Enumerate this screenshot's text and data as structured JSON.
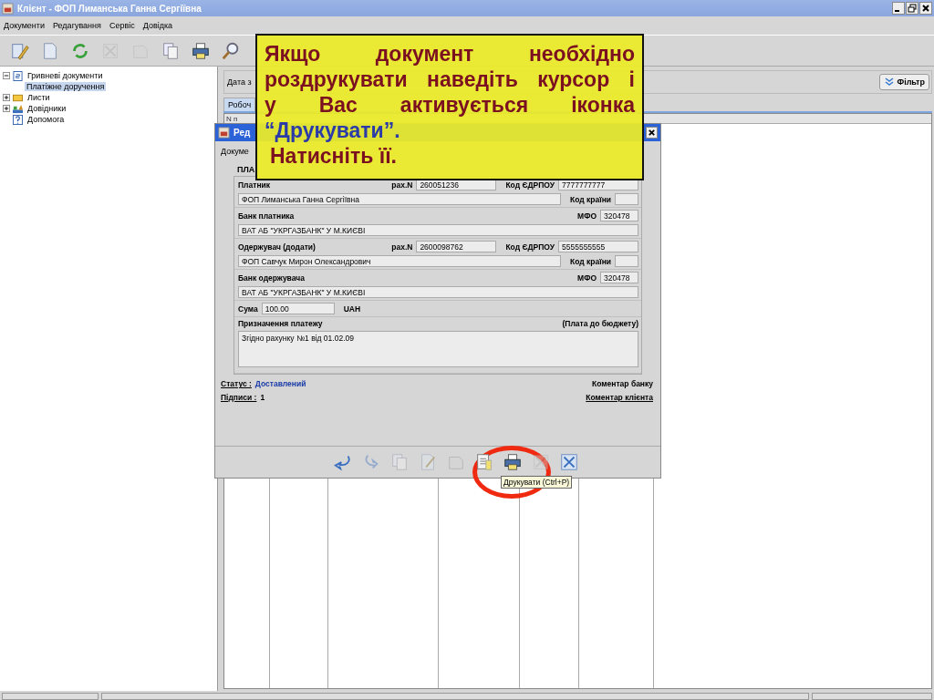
{
  "window": {
    "title": "Клієнт - ФОП Лиманська Ганна Сергіївна"
  },
  "menu": [
    "Документи",
    "Редагування",
    "Сервіс",
    "Довідка"
  ],
  "toolbar": [
    {
      "kind": "edit",
      "disabled": false
    },
    {
      "kind": "document",
      "disabled": false
    },
    {
      "kind": "refresh",
      "disabled": false
    },
    {
      "kind": "delete",
      "disabled": true
    },
    {
      "kind": "sign",
      "disabled": true
    },
    {
      "kind": "copy",
      "disabled": false
    },
    {
      "kind": "print",
      "disabled": false
    },
    {
      "kind": "search",
      "disabled": false
    }
  ],
  "tree": [
    {
      "label": "Гривневі документи",
      "kind": "doc",
      "expanded": true,
      "selected": false,
      "children": [
        {
          "label": "Платіжне доручення",
          "selected": true
        }
      ]
    },
    {
      "label": "Листи",
      "kind": "mail",
      "expanded": false,
      "selected": false
    },
    {
      "label": "Довідники",
      "kind": "books",
      "expanded": false,
      "selected": false
    },
    {
      "label": "Допомога",
      "kind": "help",
      "selected": false
    }
  ],
  "filter": {
    "date_label": "Дата з",
    "button": "Фільтр"
  },
  "tabs": [
    {
      "label": "Робоч",
      "selected": true
    }
  ],
  "table": {
    "columns": [
      "N п"
    ]
  },
  "dialog": {
    "title": "Ред",
    "document_label": "Докуме",
    "section": "ПЛА",
    "payer": {
      "label": "Платник",
      "account_label": "рах.N",
      "account": "260051236",
      "code_label": "Код ЄДРПОУ",
      "code": "7777777777",
      "name": "ФОП Лиманська Ганна Сергіївна",
      "country_label": "Код країни"
    },
    "payer_bank": {
      "label": "Банк платника",
      "mfo_label": "МФО",
      "mfo": "320478",
      "name": "ВАТ АБ \"УКРГАЗБАНК\" У М.КИЄВІ"
    },
    "recipient": {
      "label": "Одержувач  (додати)",
      "account_label": "рах.N",
      "account": "2600098762",
      "code_label": "Код ЄДРПОУ",
      "code": "5555555555",
      "name": "ФОП Савчук Мирон Олександрович",
      "country_label": "Код країни"
    },
    "recipient_bank": {
      "label": "Банк одержувача",
      "mfo_label": "МФО",
      "mfo": "320478",
      "name": "ВАТ АБ \"УКРГАЗБАНК\" У М.КИЄВІ"
    },
    "amount": {
      "label": "Сума",
      "value": "100.00",
      "currency": "UAH"
    },
    "purpose": {
      "label": "Призначення платежу",
      "note": "(Плата до бюджету)",
      "text": "Згідно рахунку №1 від 01.02.09"
    },
    "status_label": "Статус :",
    "status": "Доставлений",
    "signatures_label": "Підписи :",
    "signatures": "1",
    "bank_comment": "Коментар банку",
    "client_comment": "Коментар клієнта",
    "tools": [
      {
        "kind": "undo",
        "disabled": false
      },
      {
        "kind": "redo",
        "disabled": true
      },
      {
        "kind": "copy",
        "disabled": true
      },
      {
        "kind": "edit",
        "disabled": true
      },
      {
        "kind": "sign",
        "disabled": true
      },
      {
        "kind": "document",
        "disabled": false
      },
      {
        "kind": "print",
        "disabled": false
      },
      {
        "kind": "delete",
        "disabled": true
      },
      {
        "kind": "close",
        "disabled": false
      }
    ],
    "tooltip": "Друкувати (Ctrl+P)"
  },
  "callout": {
    "lines": [
      {
        "text": "Якщо документ необхідно",
        "emphasis": false,
        "justify": true
      },
      {
        "text": "роздрукувати наведіть курсор і",
        "emphasis": false,
        "justify": true
      },
      {
        "text": "у Вас активується іконка",
        "emphasis": false,
        "justify": true
      },
      {
        "text": "“Друкувати”.",
        "emphasis": true,
        "justify": false
      },
      {
        "text": "Натисніть її.",
        "emphasis": false,
        "justify": false
      }
    ]
  }
}
